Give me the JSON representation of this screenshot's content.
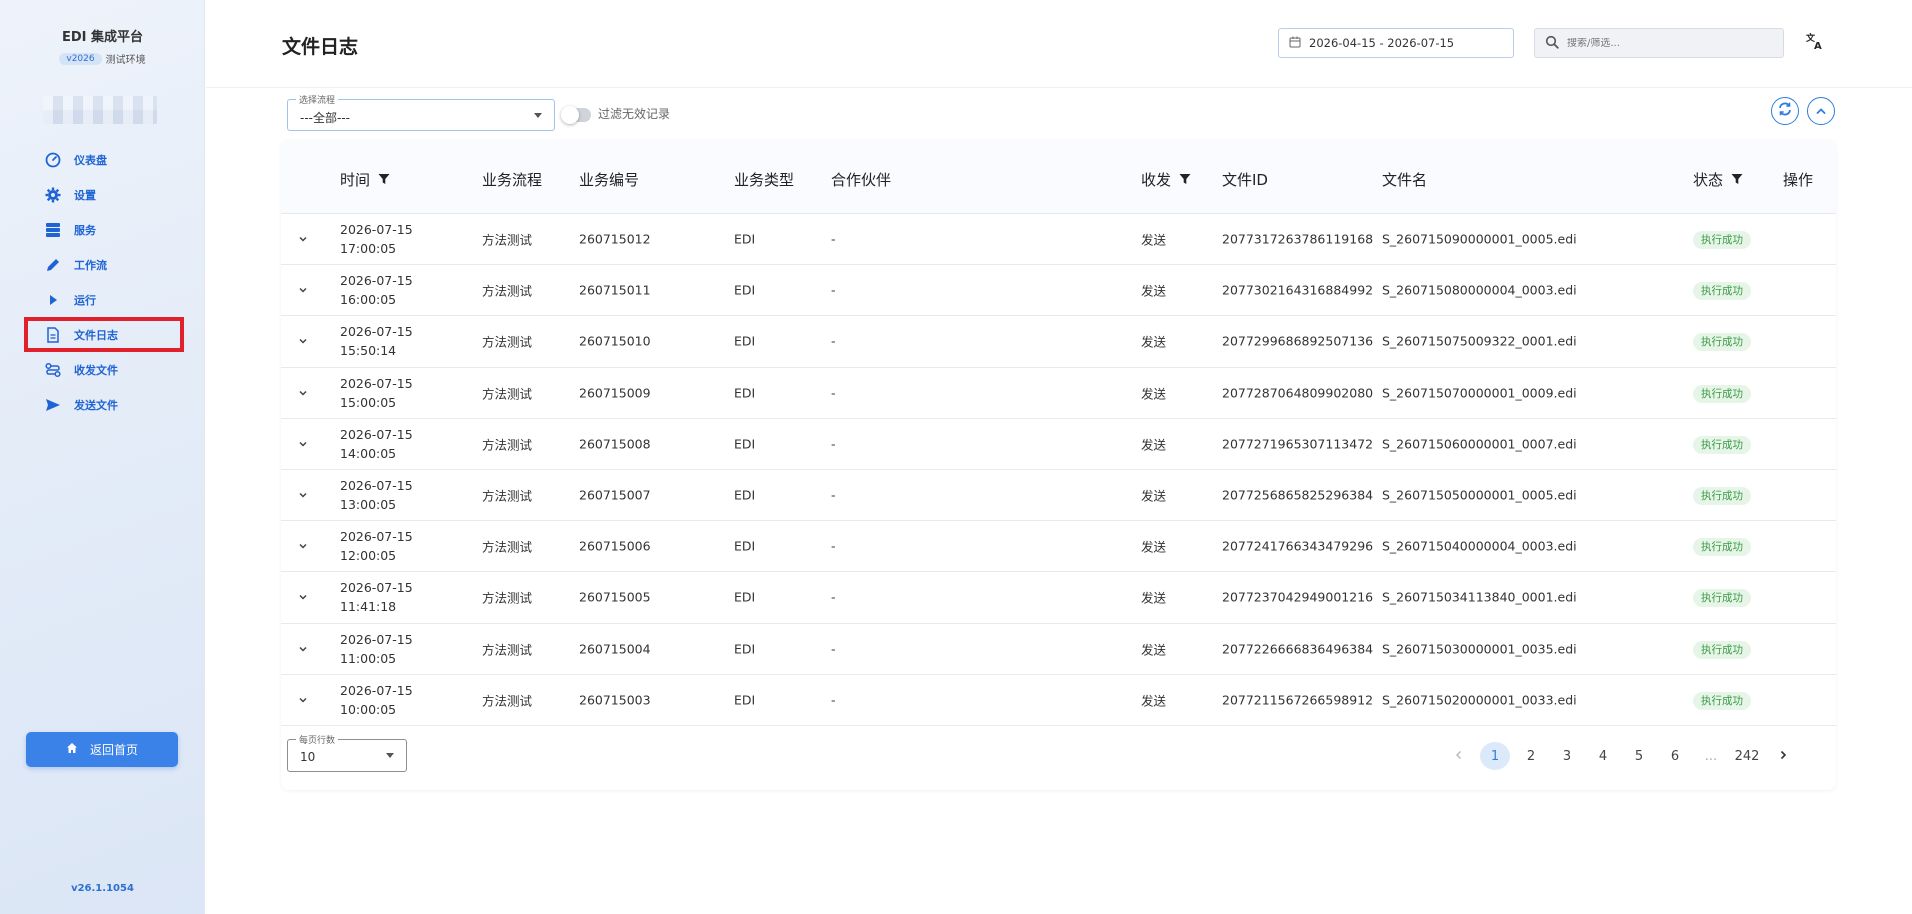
{
  "sidebar": {
    "brand_title": "EDI 集成平台",
    "version_chip": "v2026",
    "env_label": "测试环境",
    "items": [
      {
        "label": "仪表盘",
        "icon": "speedometer-icon"
      },
      {
        "label": "设置",
        "icon": "gear-icon"
      },
      {
        "label": "服务",
        "icon": "server-icon"
      },
      {
        "label": "工作流",
        "icon": "pencil-icon"
      },
      {
        "label": "运行",
        "icon": "play-icon"
      },
      {
        "label": "文件日志",
        "icon": "document-icon"
      },
      {
        "label": "收发文件",
        "icon": "transfer-icon"
      },
      {
        "label": "发送文件",
        "icon": "send-icon"
      }
    ],
    "active_index": 5,
    "home_button": "返回首页",
    "app_version": "v26.1.1054"
  },
  "header": {
    "title": "文件日志",
    "date_range": "2026-04-15 - 2026-07-15",
    "search_placeholder": "搜索/筛选..."
  },
  "filters": {
    "flow_select_legend": "选择流程",
    "flow_select_value": "---全部---",
    "filter_invalid_label": "过滤无效记录",
    "filter_invalid_on": false
  },
  "table": {
    "columns": [
      "时间",
      "业务流程",
      "业务编号",
      "业务类型",
      "合作伙伴",
      "收发",
      "文件ID",
      "文件名",
      "状态",
      "操作"
    ],
    "rows": [
      {
        "date": "2026-07-15",
        "time": "17:00:05",
        "flow": "方法测试",
        "biz_no": "260715012",
        "biz_type": "EDI",
        "partner": "-",
        "direction": "发送",
        "file_id": "2077317263786119168",
        "file_name": "S_260715090000001_0005.edi",
        "status": "执行成功"
      },
      {
        "date": "2026-07-15",
        "time": "16:00:05",
        "flow": "方法测试",
        "biz_no": "260715011",
        "biz_type": "EDI",
        "partner": "-",
        "direction": "发送",
        "file_id": "2077302164316884992",
        "file_name": "S_260715080000004_0003.edi",
        "status": "执行成功"
      },
      {
        "date": "2026-07-15",
        "time": "15:50:14",
        "flow": "方法测试",
        "biz_no": "260715010",
        "biz_type": "EDI",
        "partner": "-",
        "direction": "发送",
        "file_id": "2077299686892507136",
        "file_name": "S_260715075009322_0001.edi",
        "status": "执行成功"
      },
      {
        "date": "2026-07-15",
        "time": "15:00:05",
        "flow": "方法测试",
        "biz_no": "260715009",
        "biz_type": "EDI",
        "partner": "-",
        "direction": "发送",
        "file_id": "2077287064809902080",
        "file_name": "S_260715070000001_0009.edi",
        "status": "执行成功"
      },
      {
        "date": "2026-07-15",
        "time": "14:00:05",
        "flow": "方法测试",
        "biz_no": "260715008",
        "biz_type": "EDI",
        "partner": "-",
        "direction": "发送",
        "file_id": "2077271965307113472",
        "file_name": "S_260715060000001_0007.edi",
        "status": "执行成功"
      },
      {
        "date": "2026-07-15",
        "time": "13:00:05",
        "flow": "方法测试",
        "biz_no": "260715007",
        "biz_type": "EDI",
        "partner": "-",
        "direction": "发送",
        "file_id": "2077256865825296384",
        "file_name": "S_260715050000001_0005.edi",
        "status": "执行成功"
      },
      {
        "date": "2026-07-15",
        "time": "12:00:05",
        "flow": "方法测试",
        "biz_no": "260715006",
        "biz_type": "EDI",
        "partner": "-",
        "direction": "发送",
        "file_id": "2077241766343479296",
        "file_name": "S_260715040000004_0003.edi",
        "status": "执行成功"
      },
      {
        "date": "2026-07-15",
        "time": "11:41:18",
        "flow": "方法测试",
        "biz_no": "260715005",
        "biz_type": "EDI",
        "partner": "-",
        "direction": "发送",
        "file_id": "2077237042949001216",
        "file_name": "S_260715034113840_0001.edi",
        "status": "执行成功"
      },
      {
        "date": "2026-07-15",
        "time": "11:00:05",
        "flow": "方法测试",
        "biz_no": "260715004",
        "biz_type": "EDI",
        "partner": "-",
        "direction": "发送",
        "file_id": "2077226666836496384",
        "file_name": "S_260715030000001_0035.edi",
        "status": "执行成功"
      },
      {
        "date": "2026-07-15",
        "time": "10:00:05",
        "flow": "方法测试",
        "biz_no": "260715003",
        "biz_type": "EDI",
        "partner": "-",
        "direction": "发送",
        "file_id": "2077211567266598912",
        "file_name": "S_260715020000001_0033.edi",
        "status": "执行成功"
      }
    ]
  },
  "pagination": {
    "rows_per_page_legend": "每页行数",
    "rows_per_page": "10",
    "pages": [
      "1",
      "2",
      "3",
      "4",
      "5",
      "6",
      "...",
      "242"
    ],
    "current": "1"
  },
  "colors": {
    "accent": "#2f7de1",
    "active_border": "#e0212b",
    "status_success_bg": "#e7f5e8",
    "status_success_text": "#3a9a45"
  }
}
